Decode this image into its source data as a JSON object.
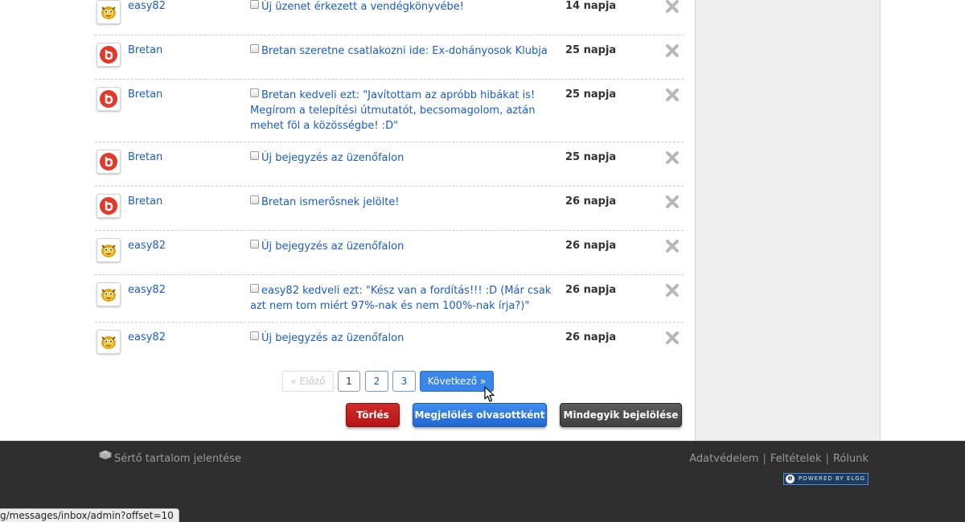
{
  "messages": [
    {
      "user": "easy82",
      "avatar": "easy82",
      "subject": "Új üzenet érkezett a vendégkönyvébe!",
      "age": "14 napja"
    },
    {
      "user": "Bretan",
      "avatar": "bretan",
      "subject": "Bretan szeretne csatlakozni ide: Ex-dohányosok Klubja",
      "age": "25 napja"
    },
    {
      "user": "Bretan",
      "avatar": "bretan",
      "subject": "Bretan kedveli ezt: \"Javítottam az apróbb hibákat is! Megírom a telepítési útmutatót, becsomagolom, aztán mehet föl a közösségbe! :D\"",
      "age": "25 napja"
    },
    {
      "user": "Bretan",
      "avatar": "bretan",
      "subject": "Új bejegyzés az üzenőfalon",
      "age": "25 napja"
    },
    {
      "user": "Bretan",
      "avatar": "bretan",
      "subject": "Bretan ismerősnek jelölte!",
      "age": "26 napja"
    },
    {
      "user": "easy82",
      "avatar": "easy82",
      "subject": "Új bejegyzés az üzenőfalon",
      "age": "26 napja"
    },
    {
      "user": "easy82",
      "avatar": "easy82",
      "subject": "easy82 kedveli ezt: \"Kész van a fordítás!!! :D (Már csak azt nem tom miért 97%-nak és nem 100%-nak írja?)\"",
      "age": "26 napja"
    },
    {
      "user": "easy82",
      "avatar": "easy82",
      "subject": "Új bejegyzés az üzenőfalon",
      "age": "26 napja"
    }
  ],
  "pagination": {
    "prev": "« Előző",
    "pages": [
      "1",
      "2",
      "3"
    ],
    "current": "1",
    "next": "Következő »"
  },
  "actions": {
    "delete": "Törlés",
    "mark_read": "Megjelölés olvasottként",
    "select_all": "Mindegyik bejelölése"
  },
  "footer": {
    "report": "Sértő tartalom jelentése",
    "links": [
      "Adatvédelem",
      "Feltételek",
      "Rólunk"
    ],
    "powered": "POWERED BY ELGG"
  },
  "statusbar": {
    "url": "g/messages/inbox/admin?offset=10"
  },
  "colors": {
    "link": "#1a5ccc",
    "delete_button": "#c21f1f",
    "mark_button": "#2f7ae0",
    "select_button": "#4a4a4a",
    "footer_bg": "#2e2e2e"
  }
}
